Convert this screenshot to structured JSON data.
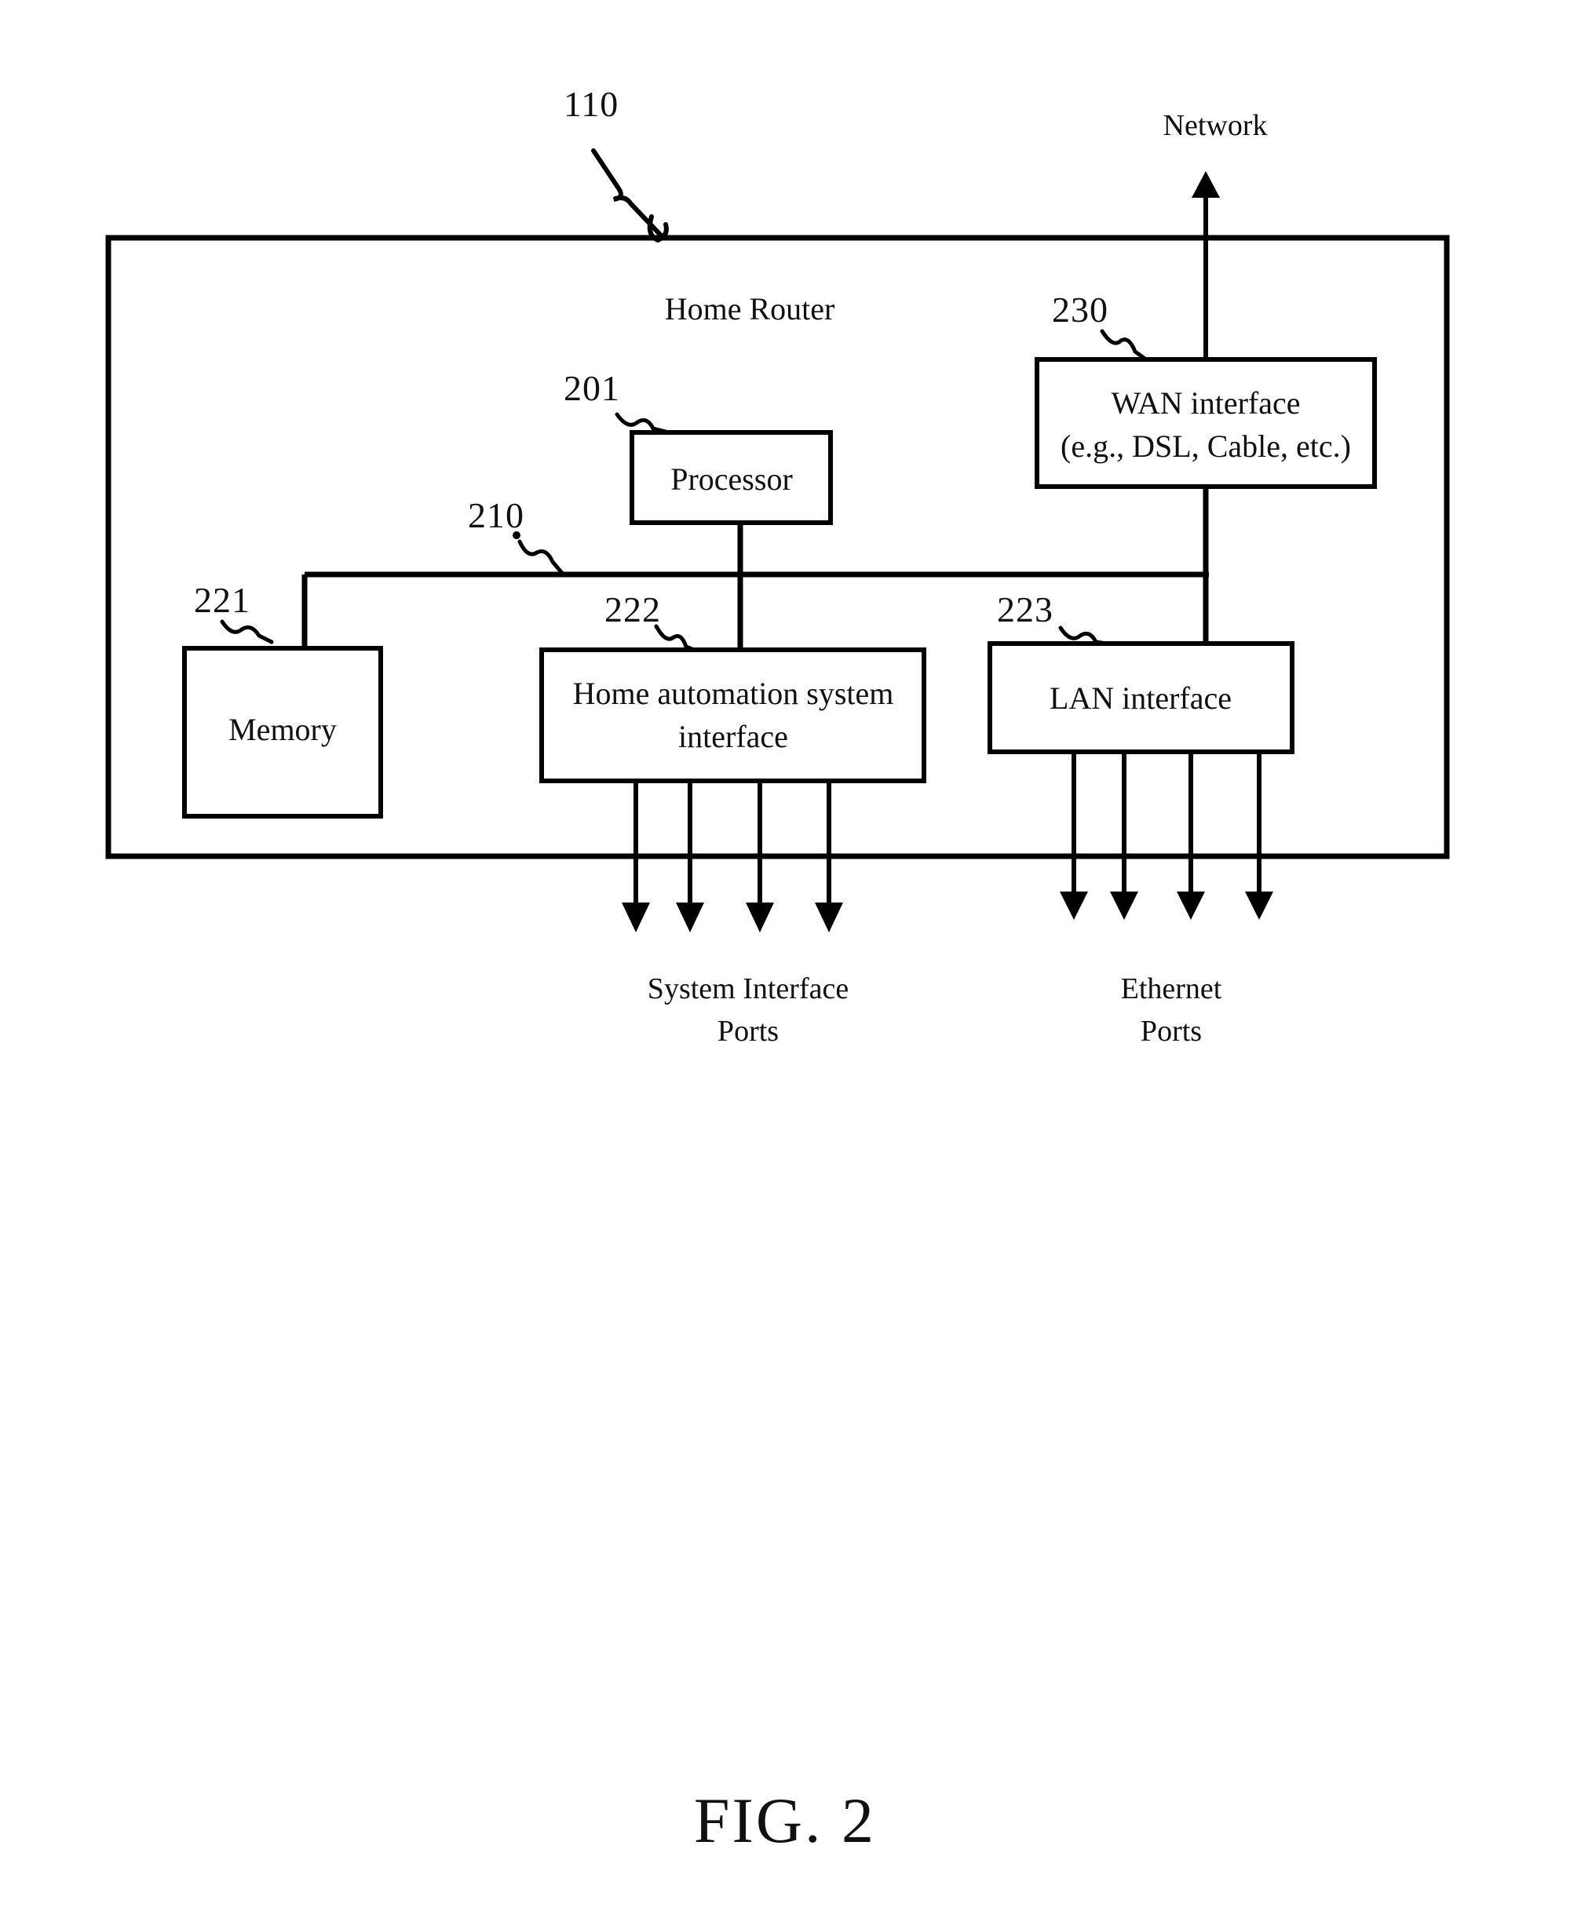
{
  "figure": {
    "caption": "FIG. 2",
    "title": "Home Router",
    "outer_ref": "110"
  },
  "external": {
    "network_label": "Network"
  },
  "blocks": [
    {
      "id": "processor",
      "ref": "201",
      "lines": [
        "Processor"
      ]
    },
    {
      "id": "memory",
      "ref": "221",
      "lines": [
        "Memory"
      ]
    },
    {
      "id": "home-automation-system-interface",
      "ref": "222",
      "lines": [
        "Home automation system",
        "interface"
      ]
    },
    {
      "id": "lan-interface",
      "ref": "223",
      "lines": [
        "LAN interface"
      ]
    },
    {
      "id": "wan-interface",
      "ref": "230",
      "lines": [
        "WAN interface",
        "(e.g., DSL, Cable, etc.)"
      ]
    }
  ],
  "bus": {
    "ref": "210"
  },
  "ports": [
    {
      "id": "system-interface-ports",
      "lines": [
        "System Interface",
        "Ports"
      ],
      "count": 4
    },
    {
      "id": "ethernet-ports",
      "lines": [
        "Ethernet",
        "Ports"
      ],
      "count": 4
    }
  ],
  "refs": {
    "outer": "110",
    "processor": "201",
    "bus": "210",
    "memory": "221",
    "home_automation": "222",
    "lan": "223",
    "wan": "230"
  },
  "text": {
    "home_router": "Home Router",
    "processor": "Processor",
    "memory": "Memory",
    "home_automation_l1": "Home automation system",
    "home_automation_l2": "interface",
    "lan_interface": "LAN interface",
    "wan_interface_l1": "WAN interface",
    "wan_interface_l2": "(e.g., DSL, Cable, etc.)",
    "network": "Network",
    "system_ports_l1": "System Interface",
    "system_ports_l2": "Ports",
    "ethernet_ports_l1": "Ethernet",
    "ethernet_ports_l2": "Ports",
    "fig_caption": "FIG. 2"
  },
  "colors": {
    "ink": "#000000",
    "background": "#ffffff"
  }
}
